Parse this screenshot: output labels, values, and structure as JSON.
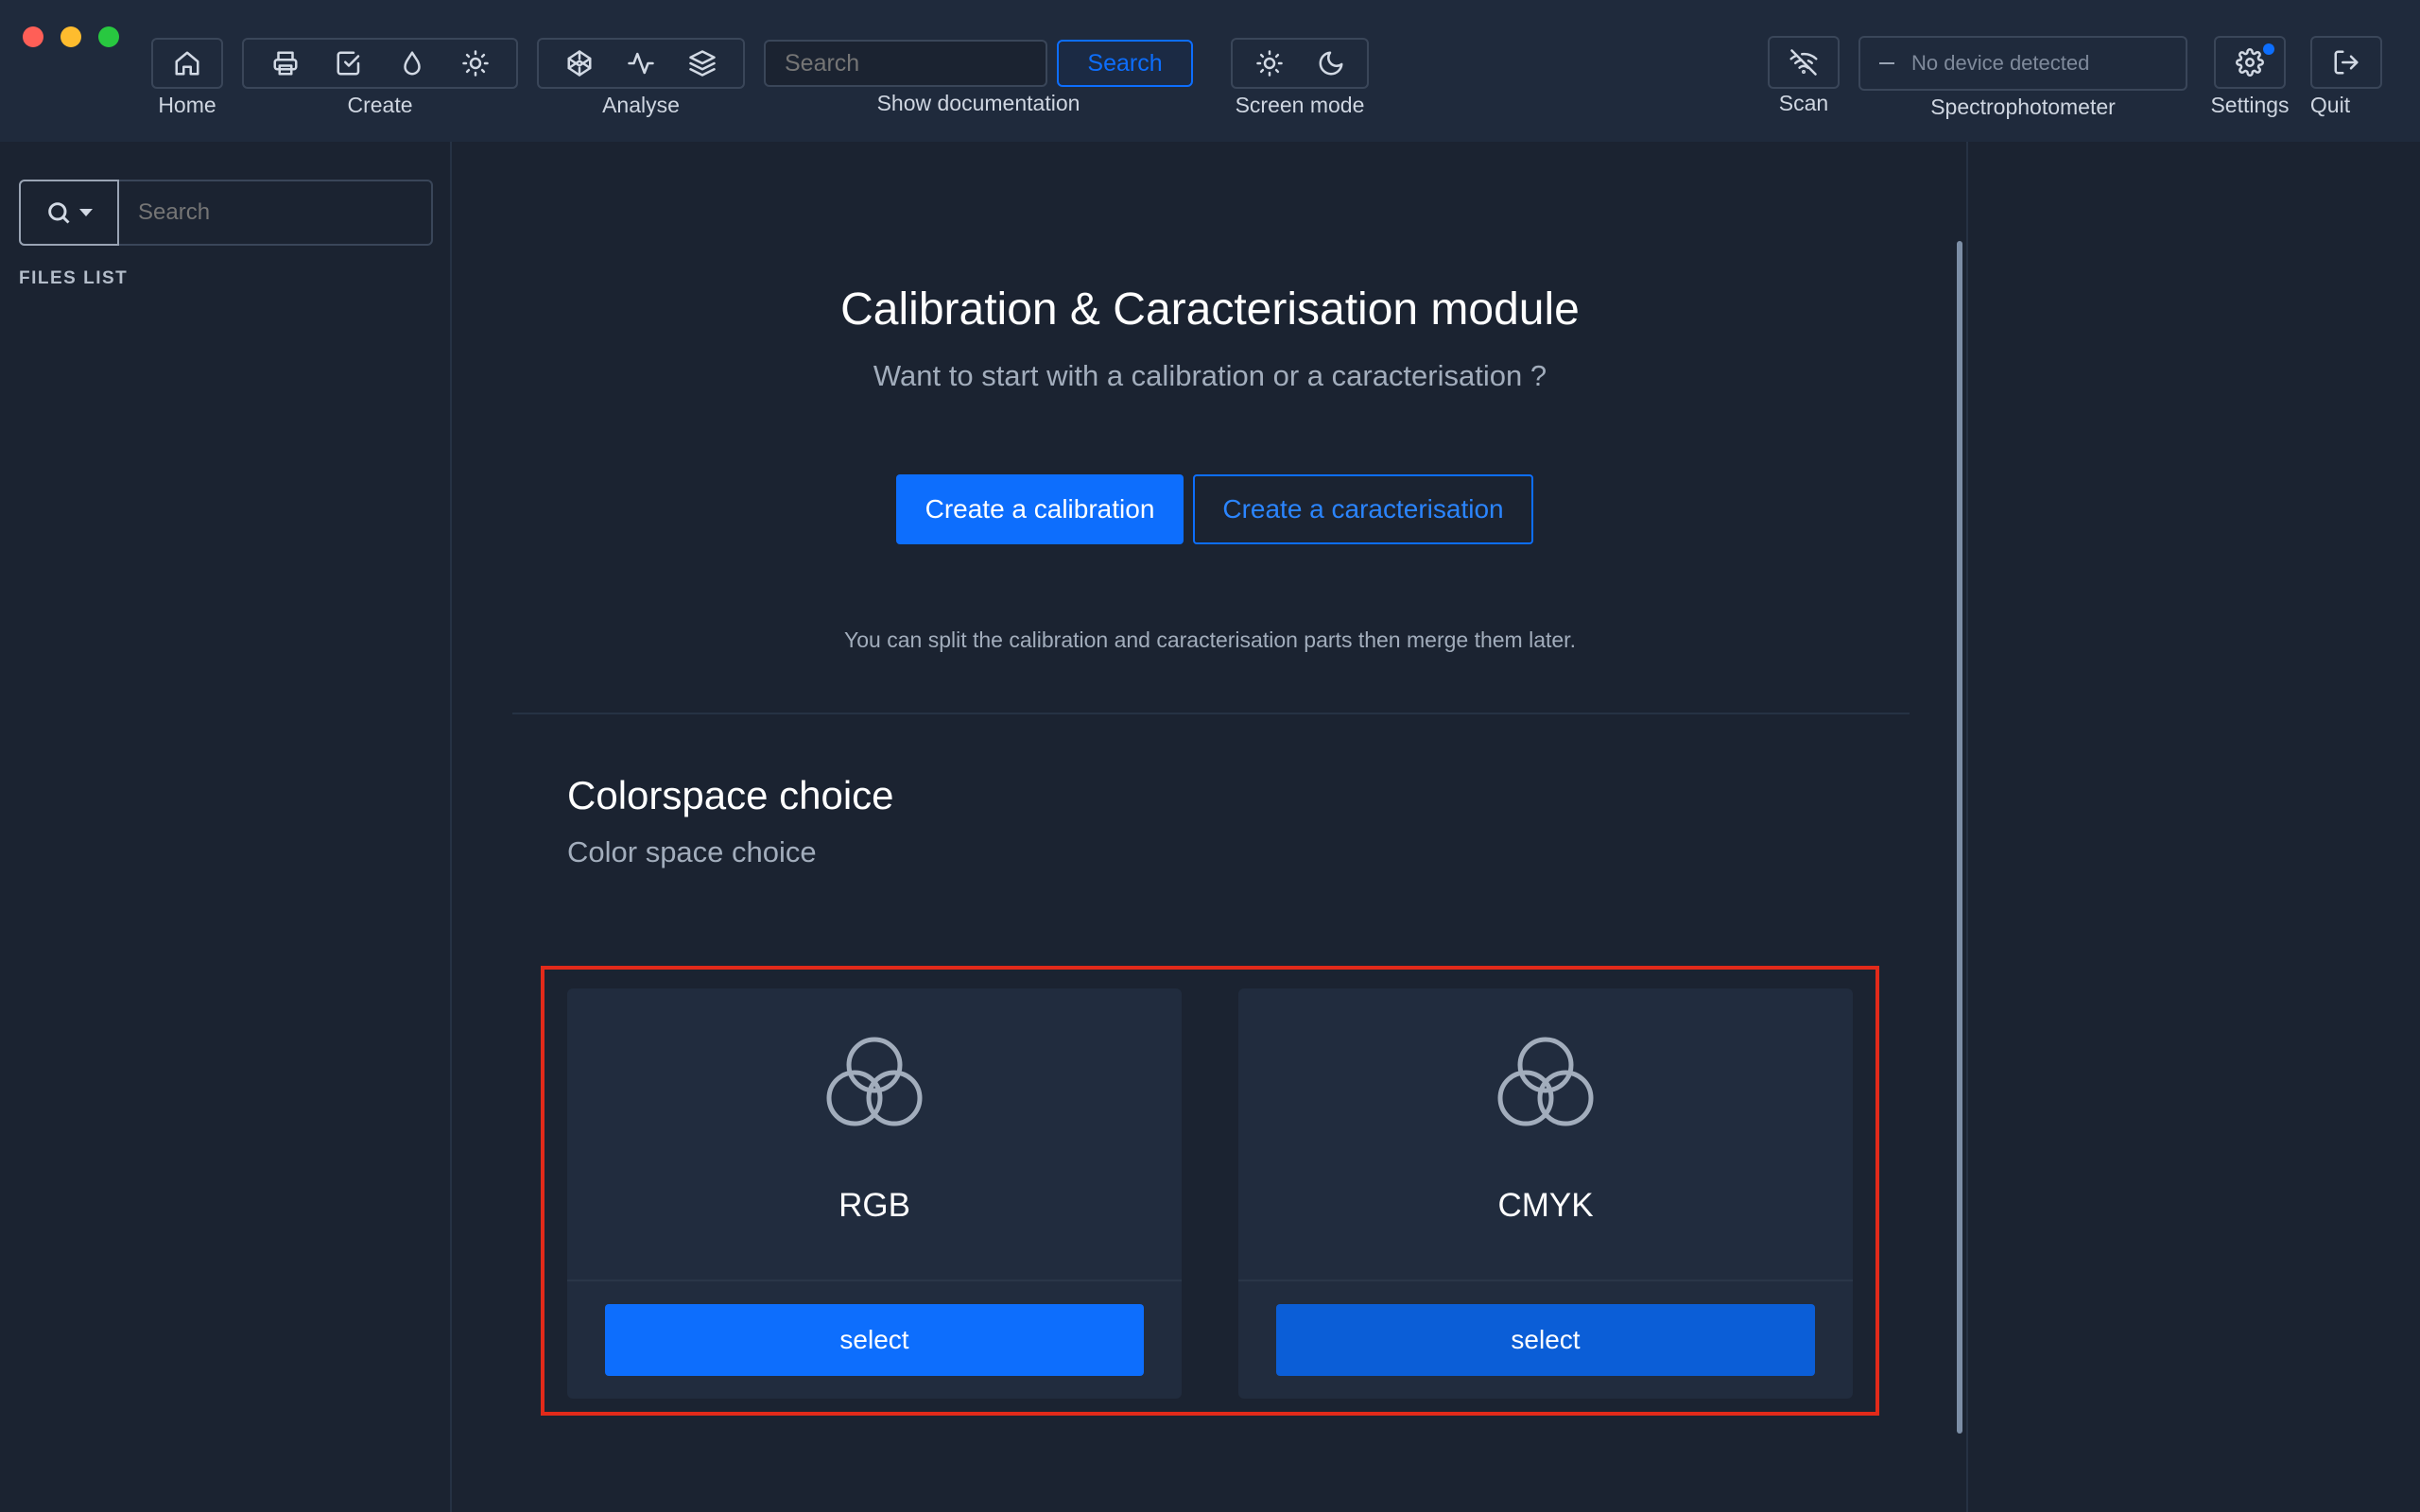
{
  "toolbar": {
    "home_label": "Home",
    "create_label": "Create",
    "analyse_label": "Analyse",
    "search_placeholder": "Search",
    "search_button": "Search",
    "doc_label": "Show documentation",
    "screen_mode_label": "Screen mode",
    "scan_label": "Scan",
    "device_status": "No device detected",
    "spectro_label": "Spectrophotometer",
    "settings_label": "Settings",
    "quit_label": "Quit",
    "accent_color": "#0d6efd"
  },
  "sidebar": {
    "search_placeholder": "Search",
    "heading": "FILES LIST"
  },
  "main": {
    "title": "Calibration & Caracterisation module",
    "subtitle": "Want to start with a calibration or a caracterisation ?",
    "create_calibration": "Create a calibration",
    "create_caracterisation": "Create a caracterisation",
    "hint": "You can split the calibration and caracterisation parts then merge them later.",
    "colorspace_title": "Colorspace choice",
    "colorspace_subtitle": "Color space choice",
    "cards": [
      {
        "label": "RGB",
        "button": "select",
        "icon": "color-circles-icon"
      },
      {
        "label": "CMYK",
        "button": "select",
        "icon": "color-circles-icon"
      }
    ]
  }
}
